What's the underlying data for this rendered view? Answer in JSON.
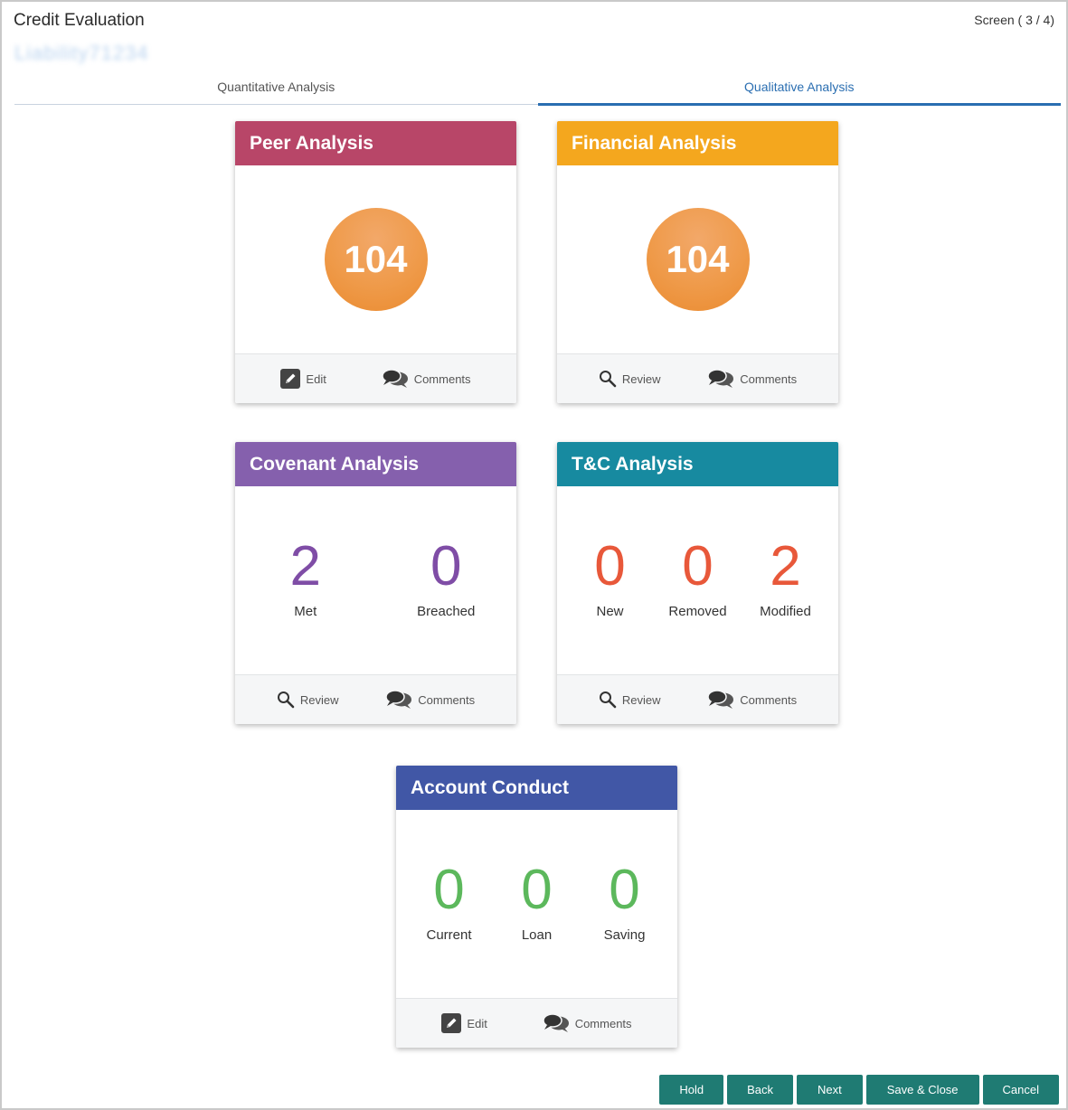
{
  "app": {
    "title": "Credit Evaluation",
    "subtitle": "Liability71234",
    "screen_indicator": "Screen ( 3 / 4)"
  },
  "tabs": [
    {
      "label": "Quantitative Analysis",
      "active": false
    },
    {
      "label": "Qualitative Analysis",
      "active": true
    }
  ],
  "cards": {
    "peer": {
      "title": "Peer Analysis",
      "header_color": "#b84668",
      "score": "104",
      "actions": {
        "primary": "Edit",
        "secondary": "Comments"
      }
    },
    "financial": {
      "title": "Financial Analysis",
      "header_color": "#f4a71e",
      "score": "104",
      "actions": {
        "primary": "Review",
        "secondary": "Comments"
      }
    },
    "covenant": {
      "title": "Covenant Analysis",
      "header_color": "#8560ad",
      "value_color": "#7f4da6",
      "metrics": [
        {
          "value": "2",
          "label": "Met"
        },
        {
          "value": "0",
          "label": "Breached"
        }
      ],
      "actions": {
        "primary": "Review",
        "secondary": "Comments"
      }
    },
    "tnc": {
      "title": "T&C Analysis",
      "header_color": "#178aa0",
      "value_color": "#e8583a",
      "metrics": [
        {
          "value": "0",
          "label": "New"
        },
        {
          "value": "0",
          "label": "Removed"
        },
        {
          "value": "2",
          "label": "Modified"
        }
      ],
      "actions": {
        "primary": "Review",
        "secondary": "Comments"
      }
    },
    "account": {
      "title": "Account Conduct",
      "header_color": "#4157a6",
      "value_color": "#5cb85c",
      "metrics": [
        {
          "value": "0",
          "label": "Current"
        },
        {
          "value": "0",
          "label": "Loan"
        },
        {
          "value": "0",
          "label": "Saving"
        }
      ],
      "actions": {
        "primary": "Edit",
        "secondary": "Comments"
      }
    }
  },
  "buttons": {
    "hold": "Hold",
    "back": "Back",
    "next": "Next",
    "save_close": "Save & Close",
    "cancel": "Cancel"
  }
}
